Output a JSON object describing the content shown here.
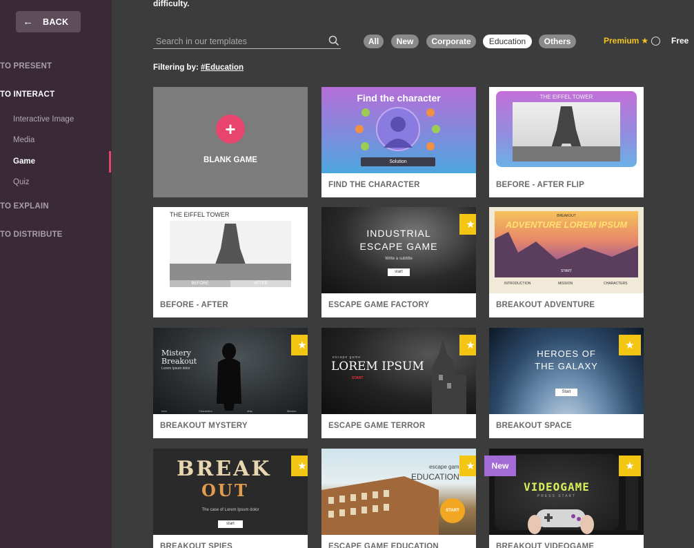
{
  "sidebar": {
    "back_label": "BACK",
    "sections": [
      {
        "label": "TO PRESENT"
      },
      {
        "label": "TO INTERACT"
      },
      {
        "label": "TO EXPLAIN"
      },
      {
        "label": "TO DISTRIBUTE"
      }
    ],
    "interact_items": [
      {
        "label": "Interactive Image"
      },
      {
        "label": "Media"
      },
      {
        "label": "Game"
      },
      {
        "label": "Quiz"
      }
    ]
  },
  "header": {
    "top_text": "difficulty."
  },
  "search": {
    "placeholder": "Search in our templates",
    "value": ""
  },
  "filters": {
    "chips": [
      {
        "label": "All"
      },
      {
        "label": "New"
      },
      {
        "label": "Corporate"
      },
      {
        "label": "Education"
      },
      {
        "label": "Others"
      }
    ],
    "selected": "Education",
    "premium_label": "Premium",
    "free_label": "Free"
  },
  "filtering": {
    "prefix": "Filtering by:",
    "tag": "#Education"
  },
  "cards": [
    {
      "title": "BLANK GAME"
    },
    {
      "title": "FIND THE CHARACTER",
      "thumb_title": "Find the character",
      "thumb_button": "Solution"
    },
    {
      "title": "BEFORE - AFTER FLIP",
      "thumb_title": "THE EIFFEL TOWER"
    },
    {
      "title": "BEFORE - AFTER",
      "thumb_title": "THE EIFFEL TOWER",
      "thumb_left": "BEFORE",
      "thumb_right": "AFTER"
    },
    {
      "title": "ESCAPE GAME FACTORY",
      "thumb_line1": "INDUSTRIAL",
      "thumb_line2": "ESCAPE GAME",
      "thumb_sub": "Write a subtitle",
      "thumb_button": "start"
    },
    {
      "title": "BREAKOUT ADVENTURE",
      "thumb_kicker": "BREAKOUT",
      "thumb_line1": "ADVENTURE LOREM IPSUM",
      "thumb_button": "START",
      "thumb_tabs": [
        "INTRODUCTION",
        "MISSION",
        "CHARACTERS"
      ]
    },
    {
      "title": "BREAKOUT MYSTERY",
      "thumb_line1": "Mistery",
      "thumb_line2": "Breakout",
      "thumb_sub": "Lorem Ipsum dolor",
      "thumb_tabs": [
        "Intro",
        "Characters",
        "Map",
        "Mission"
      ]
    },
    {
      "title": "ESCAPE GAME TERROR",
      "thumb_kicker": "escape game",
      "thumb_line1": "LOREM IPSUM",
      "thumb_button": "START"
    },
    {
      "title": "BREAKOUT SPACE",
      "thumb_line1": "HEROES OF",
      "thumb_line2": "THE GALAXY",
      "thumb_button": "Start"
    },
    {
      "title": "BREAKOUT SPIES",
      "thumb_line1": "BREAK",
      "thumb_line2": "OUT",
      "thumb_sub": "The case of Lorem Ipsum dolor",
      "thumb_button": "start"
    },
    {
      "title": "ESCAPE GAME EDUCATION",
      "thumb_kicker": "escape game",
      "thumb_line1": "EDUCATION",
      "thumb_button": "START"
    },
    {
      "title": "BREAKOUT VIDEOGAME",
      "thumb_line1": "VIDEOGAME",
      "thumb_sub": "PRESS START"
    }
  ],
  "badges": {
    "new_label": "New"
  },
  "colors": {
    "accent": "#e8456e",
    "premium": "#f4c41f",
    "star_badge": "#f3c614",
    "new_badge": "#a26bd6",
    "sidebar_bg": "#3a2a37",
    "main_bg": "#3d3c3d"
  }
}
